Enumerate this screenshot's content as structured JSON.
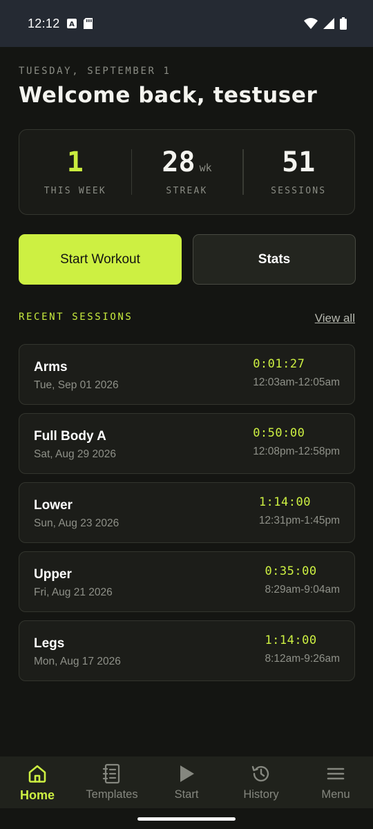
{
  "status_bar": {
    "time": "12:12"
  },
  "header": {
    "date": "TUESDAY, SEPTEMBER 1",
    "welcome": "Welcome back, testuser"
  },
  "stats": [
    {
      "value": "1",
      "unit": "",
      "label": "THIS WEEK"
    },
    {
      "value": "28",
      "unit": "wk",
      "label": "STREAK"
    },
    {
      "value": "51",
      "unit": "",
      "label": "SESSIONS"
    }
  ],
  "actions": {
    "start_workout": "Start Workout",
    "stats": "Stats"
  },
  "recent": {
    "title": "RECENT SESSIONS",
    "view_all": "View all",
    "sessions": [
      {
        "name": "Arms",
        "date": "Tue, Sep 01 2026",
        "duration": "0:01:27",
        "range": "12:03am-12:05am"
      },
      {
        "name": "Full Body A",
        "date": "Sat, Aug 29 2026",
        "duration": "0:50:00",
        "range": "12:08pm-12:58pm"
      },
      {
        "name": "Lower",
        "date": "Sun, Aug 23 2026",
        "duration": "1:14:00",
        "range": "12:31pm-1:45pm"
      },
      {
        "name": "Upper",
        "date": "Fri, Aug 21 2026",
        "duration": "0:35:00",
        "range": "8:29am-9:04am"
      },
      {
        "name": "Legs",
        "date": "Mon, Aug 17 2026",
        "duration": "1:14:00",
        "range": "8:12am-9:26am"
      }
    ]
  },
  "nav": [
    {
      "label": "Home",
      "icon": "home-icon",
      "active": true
    },
    {
      "label": "Templates",
      "icon": "notebook-icon",
      "active": false
    },
    {
      "label": "Start",
      "icon": "play-icon",
      "active": false
    },
    {
      "label": "History",
      "icon": "history-icon",
      "active": false
    },
    {
      "label": "Menu",
      "icon": "menu-icon",
      "active": false
    }
  ],
  "colors": {
    "accent": "#cdf042",
    "background": "#141512",
    "status_bar": "#252a33",
    "muted_text": "#8a8c84"
  }
}
